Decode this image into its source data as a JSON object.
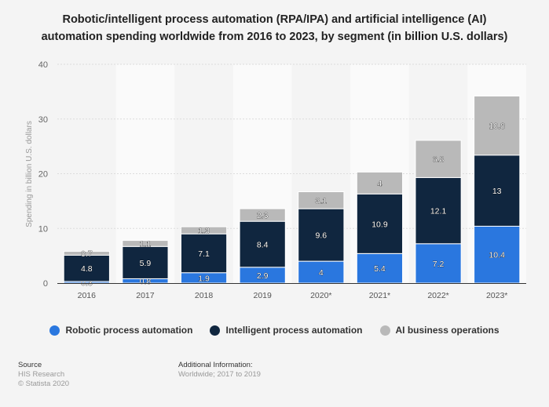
{
  "title_line1": "Robotic/intelligent process automation (RPA/IPA) and artificial intelligence (AI)",
  "title_line2": "automation spending worldwide from 2016 to 2023, by segment (in billion U.S. dollars)",
  "chart_data": {
    "type": "bar",
    "stacked": true,
    "title": "Robotic/intelligent process automation (RPA/IPA) and artificial intelligence (AI) automation spending worldwide from 2016 to 2023, by segment (in billion U.S. dollars)",
    "xlabel": "",
    "ylabel": "Spending in billion U.S. dollars",
    "ylim": [
      0,
      40
    ],
    "yticks": [
      0,
      10,
      20,
      30,
      40
    ],
    "grid": true,
    "legend_position": "bottom",
    "categories": [
      "2016",
      "2017",
      "2018",
      "2019",
      "2020*",
      "2021*",
      "2022*",
      "2023*"
    ],
    "series": [
      {
        "name": "Robotic process automation",
        "color": "#2a77df",
        "values": [
          0.3,
          0.8,
          1.9,
          2.9,
          4,
          5.4,
          7.2,
          10.4
        ],
        "labels": [
          "0.3",
          "0.8",
          "1.9",
          "2.9",
          "4",
          "5.4",
          "7.2",
          "10.4"
        ]
      },
      {
        "name": "Intelligent process automation",
        "color": "#10263f",
        "values": [
          4.8,
          5.9,
          7.1,
          8.4,
          9.6,
          10.9,
          12.1,
          13
        ],
        "labels": [
          "4.8",
          "5.9",
          "7.1",
          "8.4",
          "9.6",
          "10.9",
          "12.1",
          "13"
        ]
      },
      {
        "name": "AI business operations",
        "color": "#b9b9b9",
        "values": [
          0.7,
          1.1,
          1.3,
          2.3,
          3.1,
          4,
          6.8,
          10.8
        ],
        "labels": [
          "0.7",
          "1.1",
          "1.3",
          "2.3",
          "3.1",
          "4",
          "6.8",
          "10.8"
        ]
      }
    ]
  },
  "footer": {
    "source_label": "Source",
    "source_name": "HIS Research",
    "copyright": "© Statista 2020",
    "additional_label": "Additional Information:",
    "additional_text": "Worldwide; 2017 to 2019"
  }
}
